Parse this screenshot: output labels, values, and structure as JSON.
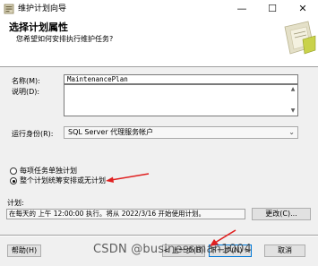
{
  "window": {
    "title": "维护计划向导",
    "minimize_glyph": "—",
    "maximize_glyph": "☐",
    "close_glyph": "✕"
  },
  "header": {
    "title": "选择计划属性",
    "subtitle": "您希望如何安排执行维护任务?"
  },
  "form": {
    "name_label": "名称(M):",
    "name_value": "MaintenancePlan",
    "description_label": "说明(D):",
    "description_value": "",
    "run_as_label": "运行身份(R):",
    "run_as_value": "SQL Server 代理服务帐户"
  },
  "schedule_options": [
    {
      "label": "每项任务单独计划",
      "selected": false
    },
    {
      "label": "整个计划统筹安排或无计划",
      "selected": true
    }
  ],
  "schedule": {
    "label": "计划:",
    "value": "在每天的 上午 12:00:00 执行。将从 2022/3/16 开始使用计划。",
    "change_button": "更改(C)..."
  },
  "footer": {
    "help_button": "帮助(H)",
    "back_button": "< 上一步(B)",
    "next_button": "下一步(N) >",
    "cancel_button": "取消"
  },
  "watermark": "CSDN @businessman1004",
  "colors": {
    "annotation_arrow": "#e02020",
    "window_background": "#f0f0f0",
    "header_background": "#ffffff"
  }
}
